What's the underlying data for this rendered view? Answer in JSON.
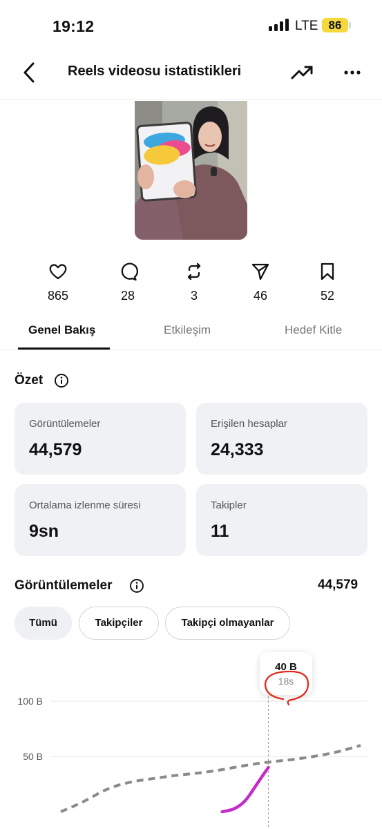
{
  "status_bar": {
    "time": "19:12",
    "network": "LTE",
    "battery": "86"
  },
  "nav": {
    "title": "Reels videosu istatistikleri",
    "back_icon": "chevron-left-icon",
    "trend_icon": "trending-up-icon",
    "more_icon": "more-horizontal-icon"
  },
  "metrics": [
    {
      "icon": "heart-icon",
      "value": "865"
    },
    {
      "icon": "comment-icon",
      "value": "28"
    },
    {
      "icon": "repost-icon",
      "value": "3"
    },
    {
      "icon": "send-icon",
      "value": "46"
    },
    {
      "icon": "bookmark-icon",
      "value": "52"
    }
  ],
  "tabs": [
    {
      "label": "Genel Bakış",
      "active": true
    },
    {
      "label": "Etkileşim",
      "active": false
    },
    {
      "label": "Hedef Kitle",
      "active": false
    }
  ],
  "summary": {
    "title": "Özet",
    "cards": [
      {
        "label": "Görüntülemeler",
        "value": "44,579"
      },
      {
        "label": "Erişilen hesaplar",
        "value": "24,333"
      },
      {
        "label": "Ortalama izlenme süresi",
        "value": "9sn"
      },
      {
        "label": "Takipler",
        "value": "11"
      }
    ]
  },
  "views": {
    "title": "Görüntülemeler",
    "total": "44,579",
    "filters": [
      {
        "label": "Tümü",
        "selected": true
      },
      {
        "label": "Takipçiler",
        "selected": false
      },
      {
        "label": "Takipçi olmayanlar",
        "selected": false
      }
    ]
  },
  "colors": {
    "accent_magenta": "#c42bc8",
    "dashed_line": "#8a8a8a",
    "annotation_red": "#e02a1c",
    "card_bg": "#f0f1f4",
    "battery": "#f4d83c"
  },
  "chart_data": {
    "type": "line",
    "ytick_labels": [
      "100 B",
      "50 B"
    ],
    "tooltip": {
      "value": "40 B",
      "time": "18s"
    },
    "series": [
      {
        "style": "dashed",
        "x": [
          0,
          2,
          4,
          6,
          8,
          10,
          12,
          14,
          16,
          18,
          20,
          22,
          24,
          26
        ],
        "y": [
          0,
          9,
          21,
          27,
          30,
          33,
          35,
          38,
          42,
          45,
          47,
          50,
          54,
          60
        ]
      },
      {
        "color": "#c42bc8",
        "x": [
          14,
          15,
          16,
          17,
          18
        ],
        "y": [
          0,
          2,
          9,
          25,
          40
        ]
      }
    ],
    "highlight_x": 18,
    "ylim": [
      0,
      100
    ],
    "annotation": "hand-drawn red circle around tooltip time"
  }
}
